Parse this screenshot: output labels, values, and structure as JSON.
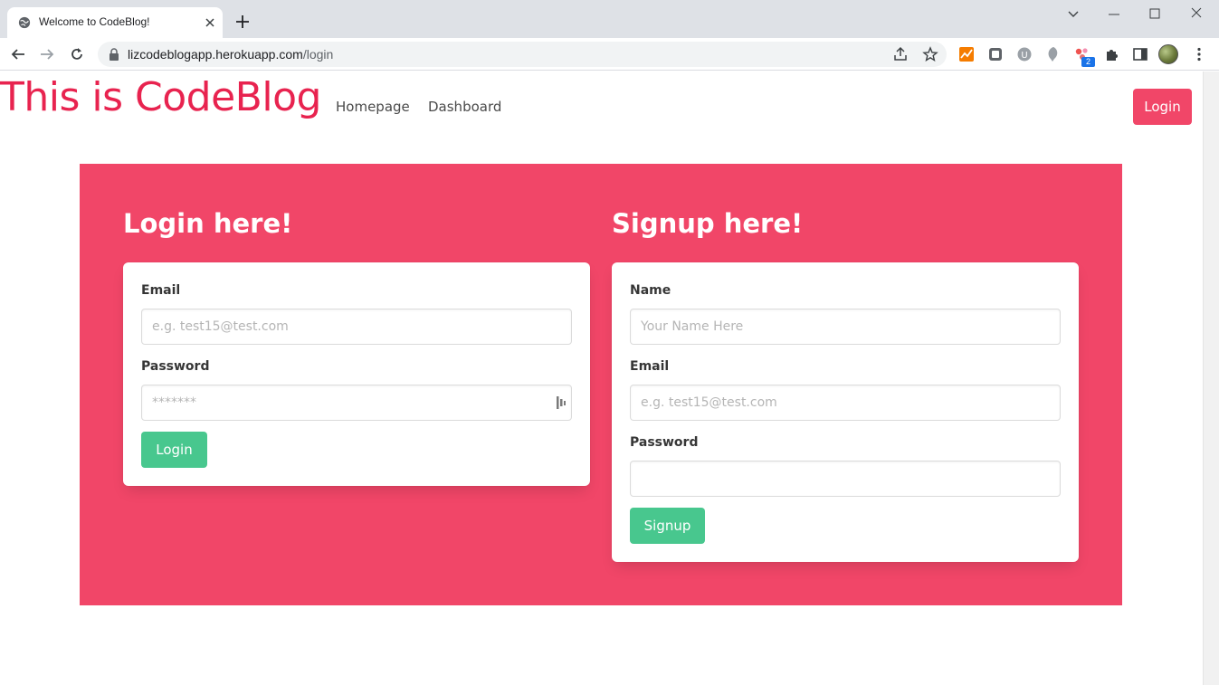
{
  "browser": {
    "tab_title": "Welcome to CodeBlog!",
    "url_host": "lizcodeblogapp.herokuapp.com",
    "url_path": "/login",
    "extension_badge": "2"
  },
  "header": {
    "brand": "This is CodeBlog",
    "nav": [
      "Homepage",
      "Dashboard"
    ],
    "login_button": "Login"
  },
  "login": {
    "title": "Login here!",
    "email_label": "Email",
    "email_placeholder": "e.g. test15@test.com",
    "password_label": "Password",
    "password_placeholder": "*******",
    "button": "Login"
  },
  "signup": {
    "title": "Signup here!",
    "name_label": "Name",
    "name_placeholder": "Your Name Here",
    "email_label": "Email",
    "email_placeholder": "e.g. test15@test.com",
    "password_label": "Password",
    "button": "Signup"
  },
  "colors": {
    "brand": "#e8234f",
    "hero": "#f14668",
    "button": "#48c78e"
  }
}
